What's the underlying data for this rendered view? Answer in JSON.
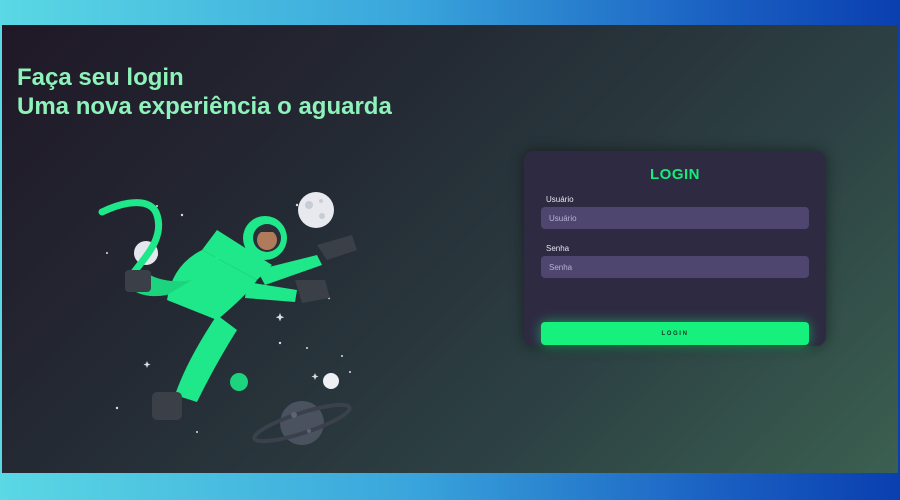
{
  "hero": {
    "line1": "Faça seu login",
    "line2": "Uma nova experiência o aguarda"
  },
  "illustration": {
    "icon": "astronaut-icon",
    "accent_color": "#1ee889"
  },
  "login": {
    "title": "LOGIN",
    "username_label": "Usuário",
    "username_placeholder": "Usuário",
    "password_label": "Senha",
    "password_placeholder": "Senha",
    "button_label": "LOGIN"
  },
  "colors": {
    "accent": "#16f07c",
    "headline": "#8ef3ba",
    "card": "#2e2a42",
    "input": "#4f4670"
  }
}
